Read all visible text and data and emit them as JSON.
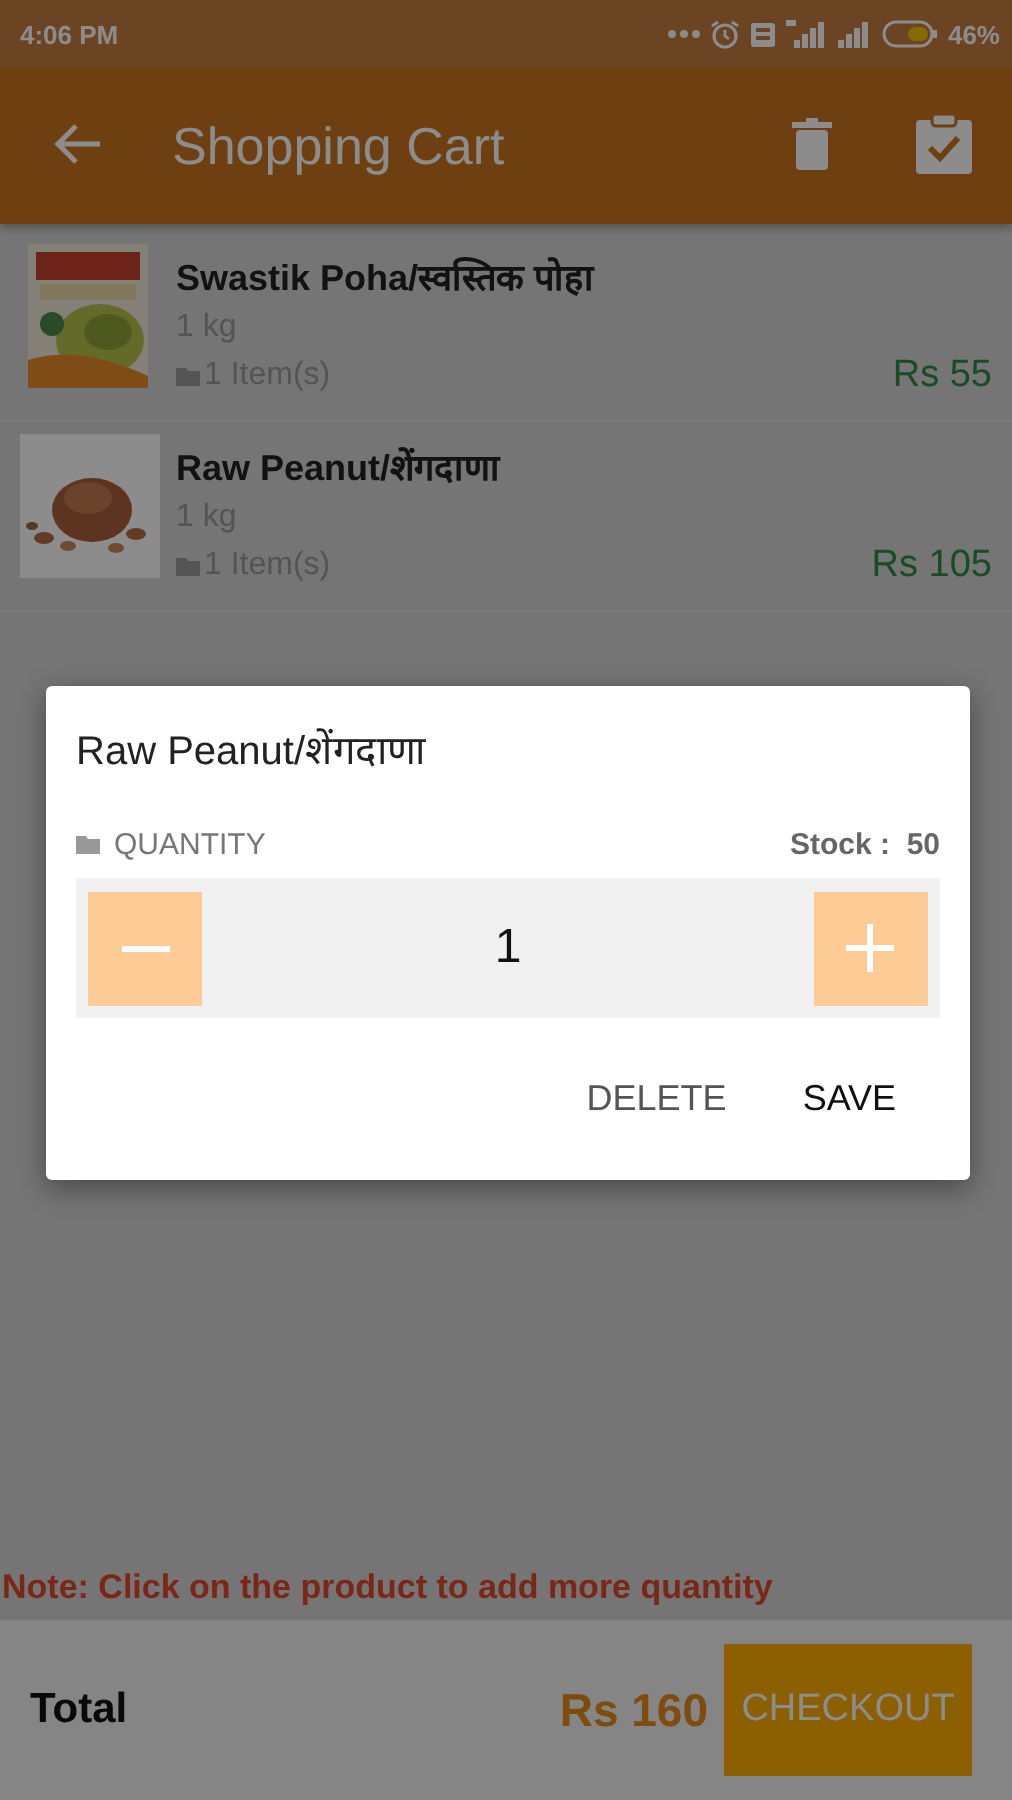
{
  "status_bar": {
    "time": "4:06 PM",
    "battery": "46%"
  },
  "app_bar": {
    "title": "Shopping Cart"
  },
  "cart_items": [
    {
      "name": "Swastik Poha/स्वस्तिक पोहा",
      "unit": "1 kg",
      "count": "1 Item(s)",
      "price": "Rs 55",
      "kind": "packet"
    },
    {
      "name": "Raw Peanut/शेंगदाणा",
      "unit": "1 kg",
      "count": "1 Item(s)",
      "price": "Rs 105",
      "kind": "pile"
    }
  ],
  "note": "Note: Click on the product to add more quantity",
  "footer": {
    "total_label": "Total",
    "total": "Rs 160",
    "checkout": "CHECKOUT"
  },
  "dialog": {
    "title": "Raw Peanut/शेंगदाणा",
    "quantity_label": "QUANTITY",
    "stock": "Stock :  50",
    "quantity": "1",
    "buttons": [
      {
        "label": "DELETE",
        "kind": "secondary"
      },
      {
        "label": "SAVE",
        "kind": "primary"
      }
    ]
  }
}
